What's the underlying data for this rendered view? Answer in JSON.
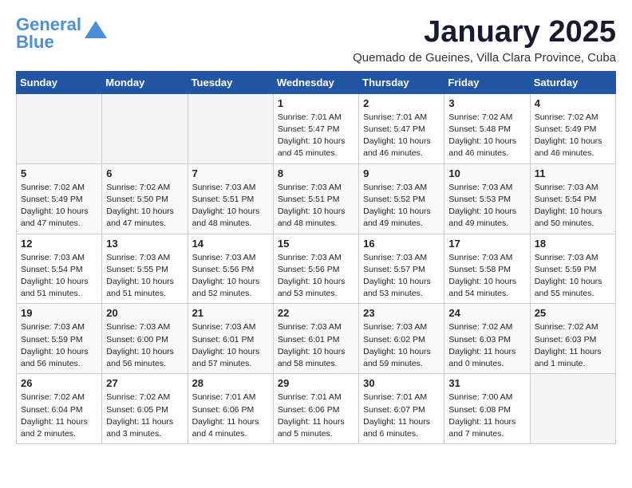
{
  "logo": {
    "line1": "General",
    "line2": "Blue"
  },
  "title": "January 2025",
  "subtitle": "Quemado de Gueines, Villa Clara Province, Cuba",
  "days_of_week": [
    "Sunday",
    "Monday",
    "Tuesday",
    "Wednesday",
    "Thursday",
    "Friday",
    "Saturday"
  ],
  "weeks": [
    [
      {
        "day": "",
        "info": ""
      },
      {
        "day": "",
        "info": ""
      },
      {
        "day": "",
        "info": ""
      },
      {
        "day": "1",
        "info": "Sunrise: 7:01 AM\nSunset: 5:47 PM\nDaylight: 10 hours\nand 45 minutes."
      },
      {
        "day": "2",
        "info": "Sunrise: 7:01 AM\nSunset: 5:47 PM\nDaylight: 10 hours\nand 46 minutes."
      },
      {
        "day": "3",
        "info": "Sunrise: 7:02 AM\nSunset: 5:48 PM\nDaylight: 10 hours\nand 46 minutes."
      },
      {
        "day": "4",
        "info": "Sunrise: 7:02 AM\nSunset: 5:49 PM\nDaylight: 10 hours\nand 46 minutes."
      }
    ],
    [
      {
        "day": "5",
        "info": "Sunrise: 7:02 AM\nSunset: 5:49 PM\nDaylight: 10 hours\nand 47 minutes."
      },
      {
        "day": "6",
        "info": "Sunrise: 7:02 AM\nSunset: 5:50 PM\nDaylight: 10 hours\nand 47 minutes."
      },
      {
        "day": "7",
        "info": "Sunrise: 7:03 AM\nSunset: 5:51 PM\nDaylight: 10 hours\nand 48 minutes."
      },
      {
        "day": "8",
        "info": "Sunrise: 7:03 AM\nSunset: 5:51 PM\nDaylight: 10 hours\nand 48 minutes."
      },
      {
        "day": "9",
        "info": "Sunrise: 7:03 AM\nSunset: 5:52 PM\nDaylight: 10 hours\nand 49 minutes."
      },
      {
        "day": "10",
        "info": "Sunrise: 7:03 AM\nSunset: 5:53 PM\nDaylight: 10 hours\nand 49 minutes."
      },
      {
        "day": "11",
        "info": "Sunrise: 7:03 AM\nSunset: 5:54 PM\nDaylight: 10 hours\nand 50 minutes."
      }
    ],
    [
      {
        "day": "12",
        "info": "Sunrise: 7:03 AM\nSunset: 5:54 PM\nDaylight: 10 hours\nand 51 minutes."
      },
      {
        "day": "13",
        "info": "Sunrise: 7:03 AM\nSunset: 5:55 PM\nDaylight: 10 hours\nand 51 minutes."
      },
      {
        "day": "14",
        "info": "Sunrise: 7:03 AM\nSunset: 5:56 PM\nDaylight: 10 hours\nand 52 minutes."
      },
      {
        "day": "15",
        "info": "Sunrise: 7:03 AM\nSunset: 5:56 PM\nDaylight: 10 hours\nand 53 minutes."
      },
      {
        "day": "16",
        "info": "Sunrise: 7:03 AM\nSunset: 5:57 PM\nDaylight: 10 hours\nand 53 minutes."
      },
      {
        "day": "17",
        "info": "Sunrise: 7:03 AM\nSunset: 5:58 PM\nDaylight: 10 hours\nand 54 minutes."
      },
      {
        "day": "18",
        "info": "Sunrise: 7:03 AM\nSunset: 5:59 PM\nDaylight: 10 hours\nand 55 minutes."
      }
    ],
    [
      {
        "day": "19",
        "info": "Sunrise: 7:03 AM\nSunset: 5:59 PM\nDaylight: 10 hours\nand 56 minutes."
      },
      {
        "day": "20",
        "info": "Sunrise: 7:03 AM\nSunset: 6:00 PM\nDaylight: 10 hours\nand 56 minutes."
      },
      {
        "day": "21",
        "info": "Sunrise: 7:03 AM\nSunset: 6:01 PM\nDaylight: 10 hours\nand 57 minutes."
      },
      {
        "day": "22",
        "info": "Sunrise: 7:03 AM\nSunset: 6:01 PM\nDaylight: 10 hours\nand 58 minutes."
      },
      {
        "day": "23",
        "info": "Sunrise: 7:03 AM\nSunset: 6:02 PM\nDaylight: 10 hours\nand 59 minutes."
      },
      {
        "day": "24",
        "info": "Sunrise: 7:02 AM\nSunset: 6:03 PM\nDaylight: 11 hours\nand 0 minutes."
      },
      {
        "day": "25",
        "info": "Sunrise: 7:02 AM\nSunset: 6:03 PM\nDaylight: 11 hours\nand 1 minute."
      }
    ],
    [
      {
        "day": "26",
        "info": "Sunrise: 7:02 AM\nSunset: 6:04 PM\nDaylight: 11 hours\nand 2 minutes."
      },
      {
        "day": "27",
        "info": "Sunrise: 7:02 AM\nSunset: 6:05 PM\nDaylight: 11 hours\nand 3 minutes."
      },
      {
        "day": "28",
        "info": "Sunrise: 7:01 AM\nSunset: 6:06 PM\nDaylight: 11 hours\nand 4 minutes."
      },
      {
        "day": "29",
        "info": "Sunrise: 7:01 AM\nSunset: 6:06 PM\nDaylight: 11 hours\nand 5 minutes."
      },
      {
        "day": "30",
        "info": "Sunrise: 7:01 AM\nSunset: 6:07 PM\nDaylight: 11 hours\nand 6 minutes."
      },
      {
        "day": "31",
        "info": "Sunrise: 7:00 AM\nSunset: 6:08 PM\nDaylight: 11 hours\nand 7 minutes."
      },
      {
        "day": "",
        "info": ""
      }
    ]
  ]
}
